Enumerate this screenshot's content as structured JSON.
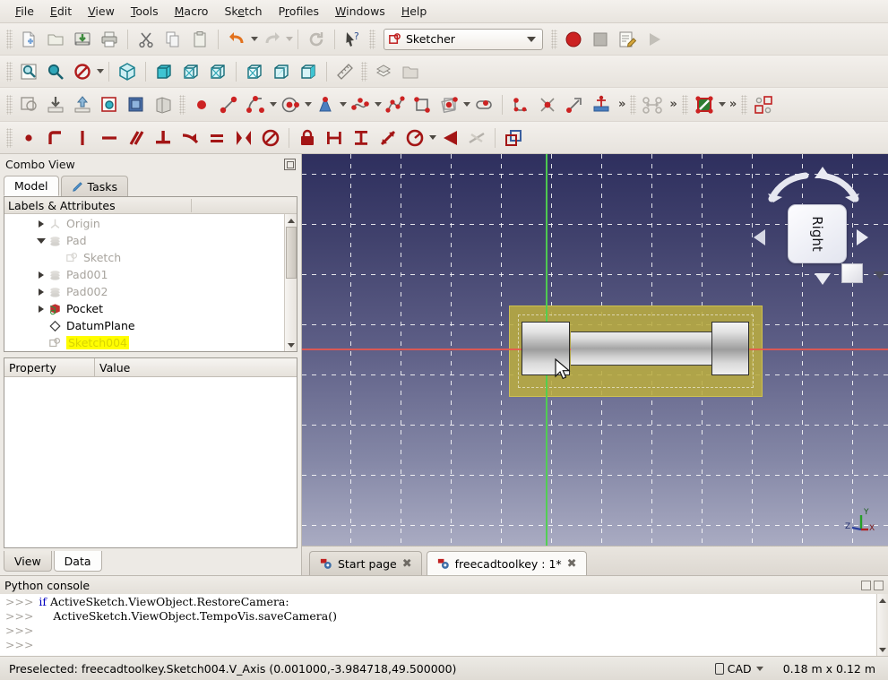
{
  "menu": {
    "items": [
      "File",
      "Edit",
      "View",
      "Tools",
      "Macro",
      "Sketch",
      "Profiles",
      "Windows",
      "Help"
    ]
  },
  "toolbars": {
    "file": [
      {
        "name": "new-file-icon",
        "title": "New"
      },
      {
        "name": "open-folder-icon",
        "title": "Open"
      },
      {
        "name": "save-icon",
        "title": "Save"
      },
      {
        "name": "print-icon",
        "title": "Print"
      },
      {
        "name": "cut-icon",
        "title": "Cut"
      },
      {
        "name": "copy-icon",
        "title": "Copy"
      },
      {
        "name": "paste-icon",
        "title": "Paste"
      },
      {
        "name": "undo-icon",
        "title": "Undo"
      },
      {
        "name": "redo-icon",
        "title": "Redo"
      },
      {
        "name": "refresh-icon",
        "title": "Refresh"
      },
      {
        "name": "whats-this-icon",
        "title": "What's This"
      }
    ],
    "workbench": {
      "label": "Sketcher",
      "icon": "sketcher-icon"
    },
    "macro": [
      {
        "name": "macro-record-icon",
        "title": "Macro recording"
      },
      {
        "name": "macro-stop-icon",
        "title": "Stop macro recording"
      },
      {
        "name": "macro-edit-icon",
        "title": "Macros"
      },
      {
        "name": "macro-execute-icon",
        "title": "Execute macro"
      }
    ],
    "view": [
      {
        "name": "fit-all-icon",
        "title": "Fit all"
      },
      {
        "name": "fit-selection-icon",
        "title": "Fit selection"
      },
      {
        "name": "draw-style-icon",
        "title": "Draw style"
      },
      {
        "name": "isometric-view-icon",
        "title": "Axonometric"
      },
      {
        "name": "front-view-icon",
        "title": "Front"
      },
      {
        "name": "top-view-icon",
        "title": "Top"
      },
      {
        "name": "right-view-icon",
        "title": "Right"
      },
      {
        "name": "rear-view-icon",
        "title": "Rear"
      },
      {
        "name": "bottom-view-icon",
        "title": "Bottom"
      },
      {
        "name": "left-view-icon",
        "title": "Left"
      },
      {
        "name": "measure-icon",
        "title": "Measure"
      },
      {
        "name": "workbench-layers-icon",
        "title": "Layers"
      },
      {
        "name": "folder-icon",
        "title": "Group"
      }
    ],
    "sketcher_edit": [
      {
        "name": "create-sketch-icon",
        "title": "Create sketch"
      },
      {
        "name": "edit-sketch-icon",
        "title": "Edit sketch"
      },
      {
        "name": "leave-sketch-icon",
        "title": "Leave sketch"
      },
      {
        "name": "view-sketch-icon",
        "title": "View sketch"
      },
      {
        "name": "view-section-icon",
        "title": "View section"
      },
      {
        "name": "map-sketch-icon",
        "title": "Map sketch to face"
      }
    ],
    "sketcher_geometry": [
      {
        "name": "point-icon",
        "title": "Create point"
      },
      {
        "name": "line-icon",
        "title": "Create line"
      },
      {
        "name": "arc-icon",
        "title": "Create arc"
      },
      {
        "name": "circle-icon",
        "title": "Create circle"
      },
      {
        "name": "conic-icon",
        "title": "Create conic"
      },
      {
        "name": "bspline-icon",
        "title": "Create B-spline"
      },
      {
        "name": "polyline-icon",
        "title": "Create polyline"
      },
      {
        "name": "rectangle-icon",
        "title": "Create rectangle"
      },
      {
        "name": "regular-polygon-icon",
        "title": "Create regular polygon"
      },
      {
        "name": "slot-icon",
        "title": "Create slot"
      },
      {
        "name": "fillet-icon",
        "title": "Create fillet"
      },
      {
        "name": "trim-icon",
        "title": "Trim edge"
      },
      {
        "name": "extend-icon",
        "title": "Extend edge"
      },
      {
        "name": "external-geometry-icon",
        "title": "External geometry"
      },
      {
        "name": "toggle-construction-icon",
        "title": "Toggle construction geometry"
      },
      {
        "name": "clone-icon",
        "title": "Clone"
      },
      {
        "name": "sketcher-visual-icon",
        "title": "Visual sketch tools"
      },
      {
        "name": "sketcher-tools-icon",
        "title": "Sketcher tools"
      }
    ],
    "sketcher_constraints": [
      {
        "name": "constrain-coincident-icon",
        "title": "Coincident"
      },
      {
        "name": "constrain-point-on-object-icon",
        "title": "Point on object"
      },
      {
        "name": "constrain-vertical-icon",
        "title": "Vertical"
      },
      {
        "name": "constrain-horizontal-icon",
        "title": "Horizontal"
      },
      {
        "name": "constrain-parallel-icon",
        "title": "Parallel"
      },
      {
        "name": "constrain-perpendicular-icon",
        "title": "Perpendicular"
      },
      {
        "name": "constrain-tangent-icon",
        "title": "Tangent"
      },
      {
        "name": "constrain-equal-icon",
        "title": "Equal"
      },
      {
        "name": "constrain-symmetric-icon",
        "title": "Symmetric"
      },
      {
        "name": "constrain-block-icon",
        "title": "Block"
      },
      {
        "name": "constrain-lock-icon",
        "title": "Lock"
      },
      {
        "name": "constrain-distance-x-icon",
        "title": "Horizontal distance"
      },
      {
        "name": "constrain-distance-y-icon",
        "title": "Vertical distance"
      },
      {
        "name": "constrain-distance-icon",
        "title": "Distance"
      },
      {
        "name": "constrain-radius-icon",
        "title": "Radius"
      },
      {
        "name": "constrain-angle-icon",
        "title": "Angle"
      },
      {
        "name": "constrain-refraction-icon",
        "title": "Refraction (Snell's law)"
      },
      {
        "name": "toggle-driving-constraint-icon",
        "title": "Toggle driving constraint"
      }
    ],
    "overflow_label": "»"
  },
  "combo_view": {
    "title": "Combo View",
    "tabs": [
      {
        "label": "Model",
        "active": true,
        "icon": "model-icon"
      },
      {
        "label": "Tasks",
        "active": false,
        "icon": "tasks-pencil-icon"
      }
    ],
    "tree_header": "Labels & Attributes",
    "tree": [
      {
        "label": "Origin",
        "icon": "origin-icon",
        "indent": 1,
        "expander": "closed",
        "dim": true,
        "highlight": false
      },
      {
        "label": "Pad",
        "icon": "pad-icon",
        "indent": 1,
        "expander": "open",
        "dim": true,
        "highlight": false
      },
      {
        "label": "Sketch",
        "icon": "sketch-icon",
        "indent": 2,
        "expander": "none",
        "dim": true,
        "highlight": false
      },
      {
        "label": "Pad001",
        "icon": "pad-icon",
        "indent": 1,
        "expander": "closed",
        "dim": true,
        "highlight": false
      },
      {
        "label": "Pad002",
        "icon": "pad-icon",
        "indent": 1,
        "expander": "closed",
        "dim": true,
        "highlight": false
      },
      {
        "label": "Pocket",
        "icon": "pocket-icon",
        "indent": 1,
        "expander": "closed",
        "dim": false,
        "highlight": false
      },
      {
        "label": "DatumPlane",
        "icon": "datum-plane-icon",
        "indent": 1,
        "expander": "none",
        "dim": false,
        "highlight": false
      },
      {
        "label": "Sketch004",
        "icon": "sketch-icon",
        "indent": 1,
        "expander": "none",
        "dim": false,
        "highlight": true
      }
    ],
    "property_columns": [
      "Property",
      "Value"
    ],
    "property_rows": [],
    "bottom_tabs": [
      {
        "label": "View",
        "active": false
      },
      {
        "label": "Data",
        "active": true
      }
    ]
  },
  "viewport": {
    "nav_cube_label": "Right",
    "axis_labels": {
      "x": "X",
      "y": "Y",
      "z": "Z"
    },
    "colors": {
      "x_axis": "#e8584f",
      "y_axis": "#4fd14f",
      "datum_plane": "#baac40",
      "background_top": "#2e2f5e",
      "background_bottom": "#a9abc2"
    }
  },
  "document_tabs": [
    {
      "label": "Start page",
      "active": false,
      "icon": "freecad-doc-icon"
    },
    {
      "label": "freecadtoolkey : 1*",
      "active": true,
      "icon": "freecad-doc-icon"
    }
  ],
  "python_console": {
    "title": "Python console",
    "lines": [
      {
        "prompt": ">>>",
        "keyword": "if ",
        "text": "ActiveSketch.ViewObject.RestoreCamera:",
        "indent": 0
      },
      {
        "prompt": ">>>",
        "keyword": "",
        "text": "ActiveSketch.ViewObject.TempoVis.saveCamera()",
        "indent": 1
      },
      {
        "prompt": ">>>",
        "keyword": "",
        "text": "",
        "indent": 0
      },
      {
        "prompt": ">>>",
        "keyword": "",
        "text": "",
        "indent": 0
      }
    ]
  },
  "status_bar": {
    "message": "Preselected: freecadtoolkey.Sketch004.V_Axis (0.001000,-3.984718,49.500000)",
    "unit_system": "CAD",
    "dimensions": "0.18 m x 0.12 m"
  }
}
